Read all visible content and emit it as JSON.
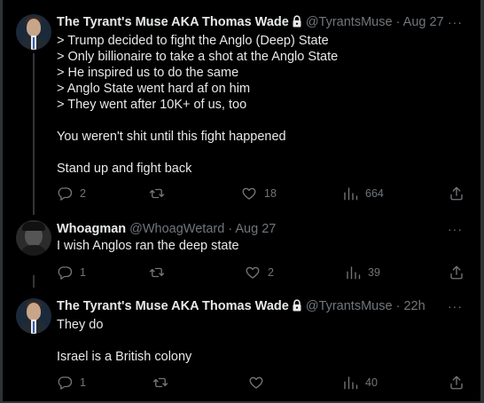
{
  "tweets": [
    {
      "display_name": "The Tyrant's Muse AKA Thomas Wade",
      "handle": "@TyrantsMuse",
      "dot": "·",
      "time": "Aug 27",
      "more": "···",
      "body": "> Trump decided to fight the Anglo (Deep) State\n> Only billionaire to take a shot at the Anglo State\n> He inspired us to do the same\n> Anglo State went hard af on him\n> They went after 10K+ of us, too\n\nYou weren't shit until this fight happened\n\nStand up and fight back",
      "replies": "2",
      "retweets": "",
      "likes": "18",
      "views": "664",
      "protected": true
    },
    {
      "display_name": "Whoagman",
      "handle": "@WhoagWetard",
      "dot": "·",
      "time": "Aug 27",
      "more": "···",
      "body": "I wish Anglos ran the deep state",
      "replies": "1",
      "retweets": "",
      "likes": "2",
      "views": "39",
      "protected": false
    },
    {
      "display_name": "The Tyrant's Muse AKA Thomas Wade",
      "handle": "@TyrantsMuse",
      "dot": "·",
      "time": "22h",
      "more": "···",
      "body": "They do\n\nIsrael is a British colony",
      "replies": "1",
      "retweets": "",
      "likes": "",
      "views": "40",
      "protected": true
    }
  ],
  "icons": {
    "reply": "reply-icon",
    "retweet": "retweet-icon",
    "like": "heart-icon",
    "views": "views-icon",
    "share": "share-icon",
    "lock": "lock-icon"
  },
  "colors": {
    "background": "#000000",
    "text": "#e7e9ea",
    "muted": "#71767b",
    "divider": "#2f3336"
  }
}
